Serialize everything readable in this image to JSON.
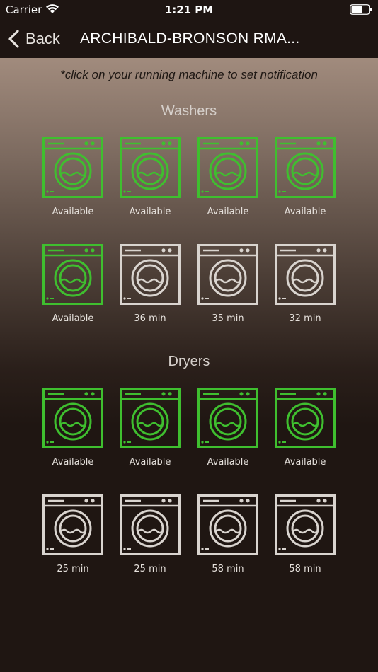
{
  "status_bar": {
    "carrier": "Carrier",
    "time": "1:21 PM"
  },
  "nav": {
    "back_label": "Back",
    "title": "ARCHIBALD-BRONSON RMA..."
  },
  "hint": "*click on your running machine to set notification",
  "colors": {
    "available": "#3fbf2f",
    "in_use": "#d9d4cf"
  },
  "washers": {
    "title": "Washers",
    "machines": [
      {
        "label": "Available",
        "status": "available"
      },
      {
        "label": "Available",
        "status": "available"
      },
      {
        "label": "Available",
        "status": "available"
      },
      {
        "label": "Available",
        "status": "available"
      },
      {
        "label": "Available",
        "status": "available"
      },
      {
        "label": "36 min",
        "status": "in_use"
      },
      {
        "label": "35 min",
        "status": "in_use"
      },
      {
        "label": "32 min",
        "status": "in_use"
      }
    ]
  },
  "dryers": {
    "title": "Dryers",
    "machines": [
      {
        "label": "Available",
        "status": "available"
      },
      {
        "label": "Available",
        "status": "available"
      },
      {
        "label": "Available",
        "status": "available"
      },
      {
        "label": "Available",
        "status": "available"
      },
      {
        "label": "25 min",
        "status": "in_use"
      },
      {
        "label": "25 min",
        "status": "in_use"
      },
      {
        "label": "58 min",
        "status": "in_use"
      },
      {
        "label": "58 min",
        "status": "in_use"
      }
    ]
  }
}
